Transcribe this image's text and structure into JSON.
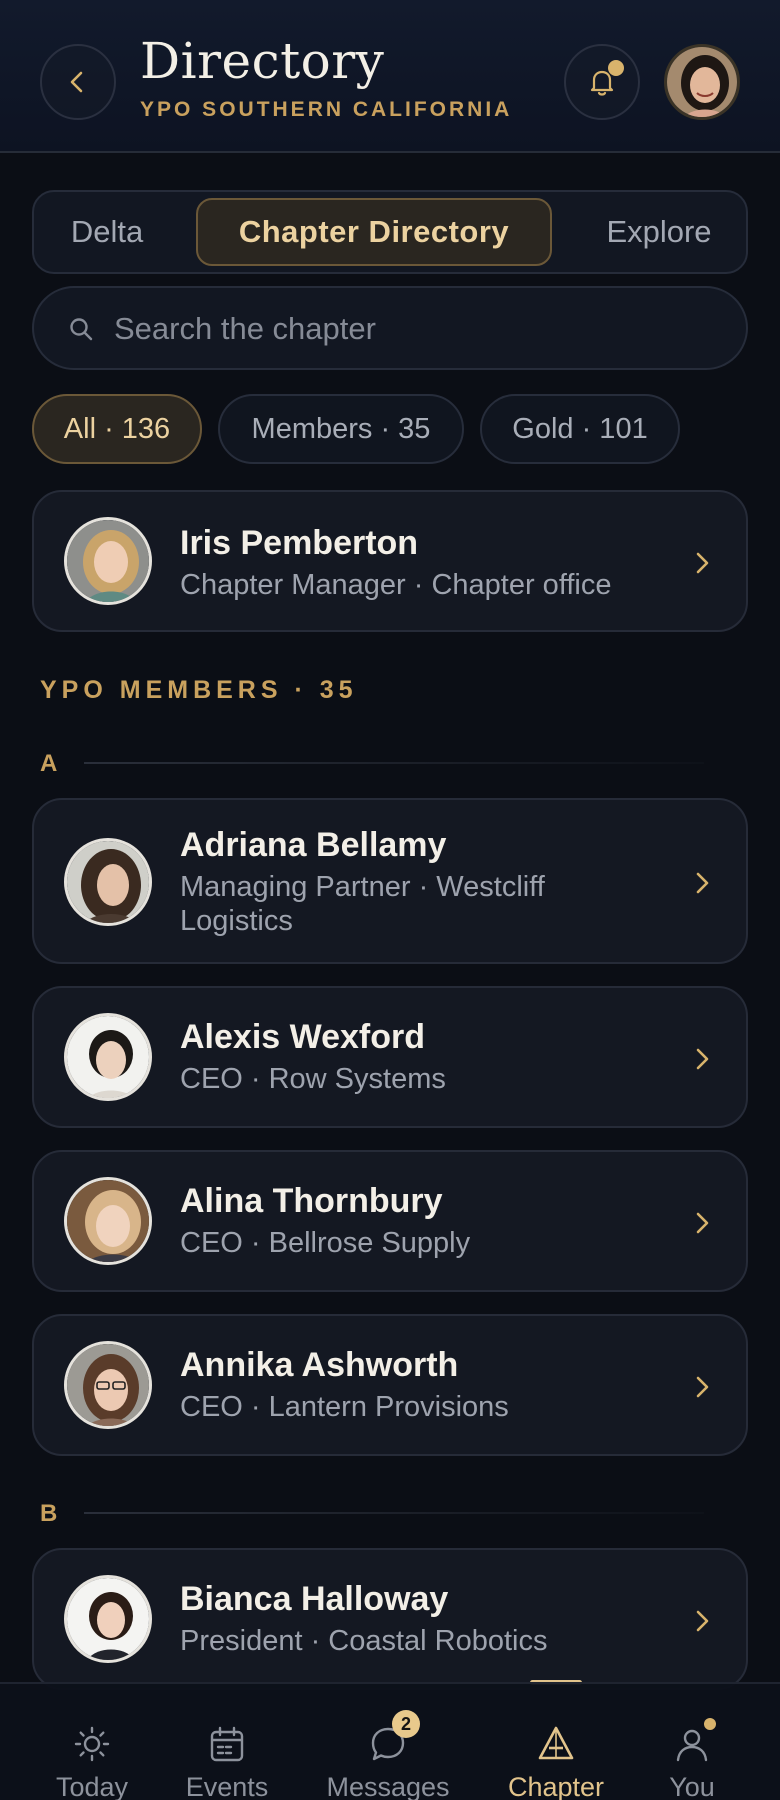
{
  "header": {
    "title": "Directory",
    "subtitle": "YPO SOUTHERN CALIFORNIA"
  },
  "tabs": [
    {
      "label": "Delta",
      "active": false
    },
    {
      "label": "Chapter Directory",
      "active": true
    },
    {
      "label": "Explore",
      "active": false
    }
  ],
  "search": {
    "placeholder": "Search the chapter",
    "value": ""
  },
  "filters": [
    {
      "label": "All · 136",
      "active": true
    },
    {
      "label": "Members · 35",
      "active": false
    },
    {
      "label": "Gold · 101",
      "active": false
    }
  ],
  "manager": {
    "name": "Iris Pemberton",
    "role": "Chapter Manager · Chapter office"
  },
  "section": {
    "title": "YPO MEMBERS · 35"
  },
  "groups": [
    {
      "letter": "A",
      "members": [
        {
          "name": "Adriana Bellamy",
          "role": "Managing Partner · Westcliff Logistics"
        },
        {
          "name": "Alexis Wexford",
          "role": "CEO · Row Systems"
        },
        {
          "name": "Alina Thornbury",
          "role": "CEO · Bellrose Supply"
        },
        {
          "name": "Annika Ashworth",
          "role": "CEO · Lantern Provisions"
        }
      ]
    },
    {
      "letter": "B",
      "members": [
        {
          "name": "Bianca Halloway",
          "role": "President · Coastal Robotics"
        }
      ]
    }
  ],
  "tabbar": [
    {
      "label": "Today",
      "icon": "sun-icon",
      "active": false
    },
    {
      "label": "Events",
      "icon": "calendar-icon",
      "active": false
    },
    {
      "label": "Messages",
      "icon": "chat-bubble-icon",
      "active": false,
      "badge": "2"
    },
    {
      "label": "Chapter",
      "icon": "chapter-a-icon",
      "active": true
    },
    {
      "label": "You",
      "icon": "person-icon",
      "active": false
    }
  ],
  "colors": {
    "accent": "#c9a15e",
    "background": "#0b0e15",
    "card": "#141822"
  }
}
